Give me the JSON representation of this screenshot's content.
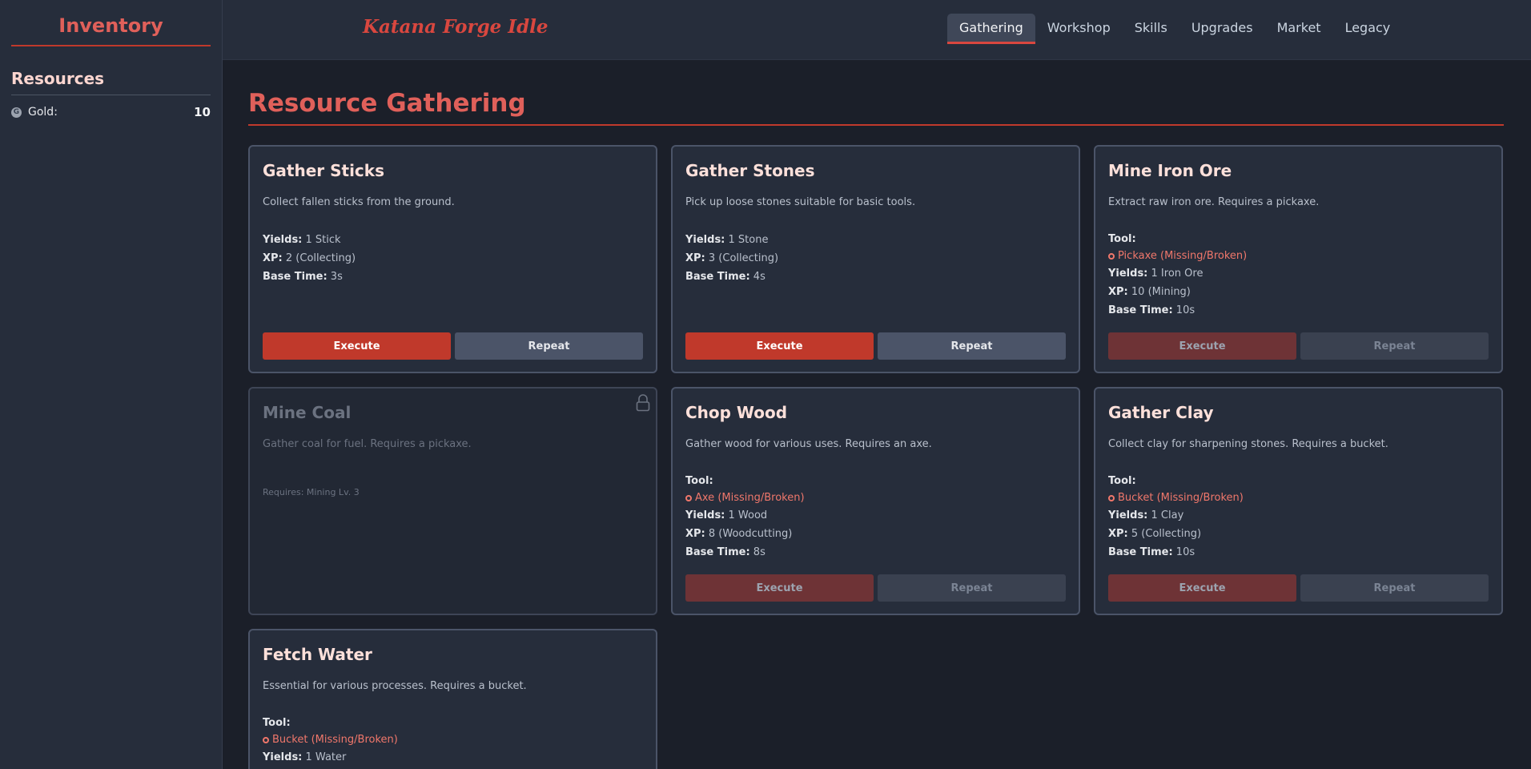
{
  "sidebar": {
    "title": "Inventory",
    "section": "Resources",
    "resources": [
      {
        "label": "Gold:",
        "value": "10",
        "icon": "gold-coin-icon"
      }
    ]
  },
  "header": {
    "game_title": "Katana Forge Idle",
    "tabs": [
      "Gathering",
      "Workshop",
      "Skills",
      "Upgrades",
      "Market",
      "Legacy"
    ],
    "active_tab": "Gathering"
  },
  "main": {
    "title": "Resource Gathering",
    "cards": [
      {
        "title": "Gather Sticks",
        "desc": "Collect fallen sticks from the ground.",
        "yields": "1 Stick",
        "xp": "2 (Collecting)",
        "time": "3s",
        "execute": "Execute",
        "repeat": "Repeat"
      },
      {
        "title": "Gather Stones",
        "desc": "Pick up loose stones suitable for basic tools.",
        "yields": "1 Stone",
        "xp": "3 (Collecting)",
        "time": "4s",
        "execute": "Execute",
        "repeat": "Repeat"
      },
      {
        "title": "Mine Iron Ore",
        "desc": "Extract raw iron ore. Requires a pickaxe.",
        "tool_label": "Tool:",
        "tool": "Pickaxe (Missing/Broken)",
        "yields": "1 Iron Ore",
        "xp": "10 (Mining)",
        "time": "10s",
        "execute": "Execute",
        "repeat": "Repeat"
      },
      {
        "title": "Mine Coal",
        "desc": "Gather coal for fuel. Requires a pickaxe.",
        "requires": "Requires: Mining Lv. 3"
      },
      {
        "title": "Chop Wood",
        "desc": "Gather wood for various uses. Requires an axe.",
        "tool_label": "Tool:",
        "tool": "Axe (Missing/Broken)",
        "yields": "1 Wood",
        "xp": "8 (Woodcutting)",
        "time": "8s",
        "execute": "Execute",
        "repeat": "Repeat"
      },
      {
        "title": "Gather Clay",
        "desc": "Collect clay for sharpening stones. Requires a bucket.",
        "tool_label": "Tool:",
        "tool": "Bucket (Missing/Broken)",
        "yields": "1 Clay",
        "xp": "5 (Collecting)",
        "time": "10s",
        "execute": "Execute",
        "repeat": "Repeat"
      },
      {
        "title": "Fetch Water",
        "desc": "Essential for various processes. Requires a bucket.",
        "tool_label": "Tool:",
        "tool": "Bucket (Missing/Broken)",
        "yields": "1 Water"
      }
    ],
    "labels": {
      "yields": "Yields:",
      "xp": "XP:",
      "time": "Base Time:"
    }
  },
  "colors": {
    "accent": "#c0392b",
    "title": "#e0605a",
    "missing": "#f0776b"
  }
}
